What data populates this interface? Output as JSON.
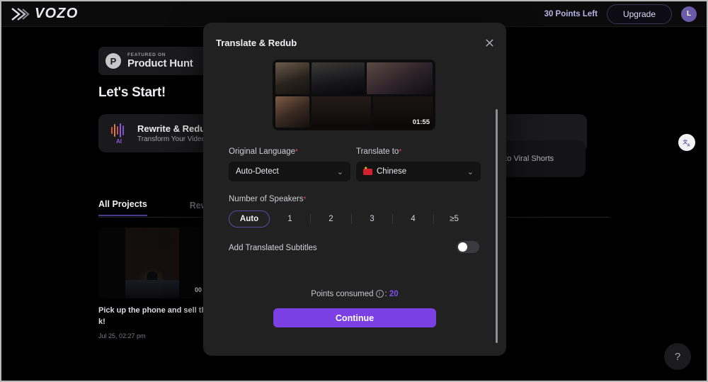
{
  "topbar": {
    "logo_text": "VOZO",
    "points_left": "30 Points Left",
    "upgrade_label": "Upgrade",
    "avatar_initial": "L"
  },
  "background": {
    "product_hunt": {
      "featured_on": "FEATURED ON",
      "name": "Product Hunt",
      "mark": "P"
    },
    "heading": "Let's Start!",
    "feature_card": {
      "title": "Rewrite & Redub",
      "subtitle": "Transform Your Video Sto",
      "badge": "AI"
    },
    "viral_card": {
      "text": "os into Viral Shorts"
    },
    "tabs": [
      {
        "label": "All Projects",
        "active": true
      },
      {
        "label": "Rewritte",
        "active": false
      }
    ],
    "project": {
      "duration": "00",
      "title": "Pick up the phone and sell the st k!",
      "date": "Jul 25, 02:27 pm"
    },
    "help_label": "?"
  },
  "modal": {
    "title": "Translate & Redub",
    "close_icon": "close-icon",
    "video": {
      "duration": "01:55"
    },
    "original_language": {
      "label": "Original Language",
      "required_mark": "*",
      "value": "Auto-Detect"
    },
    "translate_to": {
      "label": "Translate to",
      "required_mark": "*",
      "value": "Chinese"
    },
    "speakers": {
      "label": "Number of Speakers",
      "required_mark": "*",
      "options": [
        "Auto",
        "1",
        "2",
        "3",
        "4",
        "≥5"
      ],
      "selected": "Auto"
    },
    "subtitles": {
      "label": "Add Translated Subtitles",
      "enabled": false
    },
    "points": {
      "prefix": "Points consumed",
      "separator": ":",
      "value": "20"
    },
    "continue_label": "Continue"
  },
  "colors": {
    "accent_purple": "#7b3fe4",
    "points_purple": "#7f4ff0",
    "required_red": "#e0465c",
    "modal_bg": "#212121",
    "page_bg": "#000000"
  }
}
